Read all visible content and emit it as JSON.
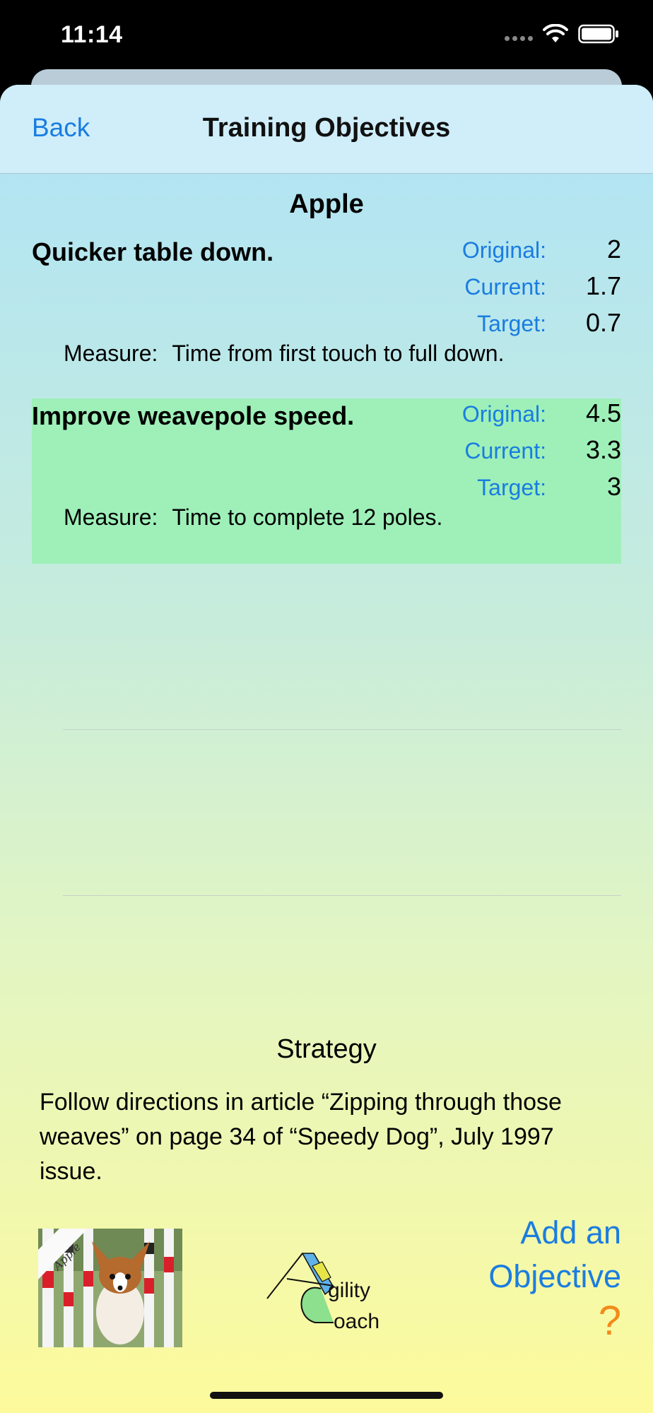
{
  "status_bar": {
    "time": "11:14"
  },
  "nav": {
    "back_label": "Back",
    "title": "Training Objectives"
  },
  "dog_name": "Apple",
  "objectives": [
    {
      "title": "Quicker table down.",
      "original_label": "Original:",
      "original": "2",
      "current_label": "Current:",
      "current": "1.7",
      "target_label": "Target:",
      "target": "0.7",
      "measure_label": "Measure:",
      "measure": "Time from first touch to full down.",
      "highlighted": false
    },
    {
      "title": "Improve weavepole speed.",
      "original_label": "Original:",
      "original": "4.5",
      "current_label": "Current:",
      "current": "3.3",
      "target_label": "Target:",
      "target": "3",
      "measure_label": "Measure:",
      "measure": "Time to complete 12 poles.",
      "highlighted": true
    }
  ],
  "strategy": {
    "title": "Strategy",
    "text": "Follow directions in article “Zipping through those weaves” on page 34 of “Speedy Dog”, July 1997 issue."
  },
  "photo": {
    "caption": "Apple"
  },
  "logo": {
    "line1": "gility",
    "line2": "oach"
  },
  "actions": {
    "add_objective_line1": "Add an",
    "add_objective_line2": "Objective",
    "help": "?"
  },
  "colors": {
    "accent": "#1a7de0",
    "highlight": "#9ef0b8",
    "help": "#f28a1a"
  },
  "icons": [
    "signal-icon",
    "wifi-icon",
    "battery-icon"
  ]
}
